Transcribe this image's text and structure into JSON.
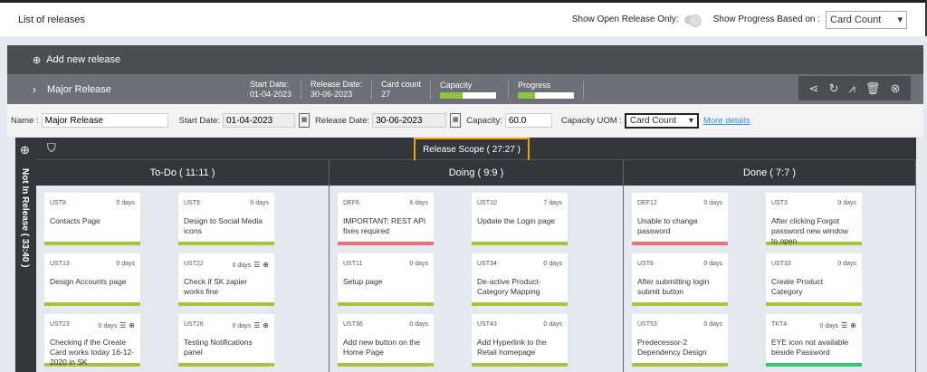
{
  "header": {
    "title": "List of releases",
    "open_only_label": "Show Open Release Only:",
    "progress_label": "Show Progress Based on :",
    "progress_value": "Card Count"
  },
  "add_release": "Add new release",
  "release": {
    "name": "Major Release",
    "start_label": "Start Date:",
    "start": "01-04-2023",
    "release_label": "Release Date:",
    "release": "30-06-2023",
    "card_label": "Card count",
    "card_count": "27",
    "capacity_label": "Capacity",
    "capacity_fill": 0.4,
    "progress_label": "Progress",
    "progress_fill": 0.3
  },
  "form": {
    "name_label": "Name :",
    "name": "Major Release",
    "start_label": "Start Date:",
    "start": "01-04-2023",
    "release_label": "Release Date:",
    "release": "30-06-2023",
    "capacity_label": "Capacity:",
    "capacity": "60.0",
    "uom_label": "Capacity UOM :",
    "uom": "Card Count",
    "more": "More details"
  },
  "board": {
    "not_in_release": "Not In Release ( 33:40 )",
    "scope": "Release Scope ( 27:27 )",
    "columns": [
      {
        "title": "To-Do ( 11:11 )",
        "cards": [
          {
            "id": "UST8",
            "days": "0 days",
            "title": "Contacts Page",
            "color": "#a5c63b",
            "icons": false
          },
          {
            "id": "UST9",
            "days": "0 days",
            "title": "Design to Social Media icons",
            "color": "#a5c63b",
            "icons": false
          },
          {
            "id": "UST13",
            "days": "0 days",
            "title": "Design Accounts page",
            "color": "#a5c63b",
            "icons": false
          },
          {
            "id": "UST22",
            "days": "0 days",
            "title": "Check if SK zapier works fine",
            "color": "#a5c63b",
            "icons": true
          },
          {
            "id": "UST23",
            "days": "0 days",
            "title": "Checking if the Create Card works today 16-12-2020 in SK",
            "color": "#a5c63b",
            "icons": true
          },
          {
            "id": "UST26",
            "days": "0 days",
            "title": "Testing Notifications panel",
            "color": "#a5c63b",
            "icons": true
          }
        ]
      },
      {
        "title": "Doing ( 9:9 )",
        "cards": [
          {
            "id": "DEF6",
            "days": "6 days",
            "title": "IMPORTANT: REST API fixes required",
            "color": "#ef6f78",
            "icons": false
          },
          {
            "id": "UST10",
            "days": "7 days",
            "title": "Update the Login page",
            "color": "#a5c63b",
            "icons": false
          },
          {
            "id": "UST11",
            "days": "0 days",
            "title": "Setup page",
            "color": "#a5c63b",
            "icons": false
          },
          {
            "id": "UST34",
            "days": "0 days",
            "title": "De-active Product-Category Mapping",
            "color": "#a5c63b",
            "icons": false
          },
          {
            "id": "UST36",
            "days": "0 days",
            "title": "Add new button on the Home Page",
            "color": "#a5c63b",
            "icons": false
          },
          {
            "id": "UST43",
            "days": "0 days",
            "title": "Add Hyperlink to the Retail homepage",
            "color": "#a5c63b",
            "icons": false
          }
        ]
      },
      {
        "title": "Done ( 7:7 )",
        "cards": [
          {
            "id": "DEF12",
            "days": "0 days",
            "title": "Unable to change password",
            "color": "#ef6f78",
            "icons": false
          },
          {
            "id": "UST3",
            "days": "0 days",
            "title": "After clicking Forgot password new window to open",
            "color": "#a5c63b",
            "icons": false
          },
          {
            "id": "UST6",
            "days": "0 days",
            "title": "After submitting login submit button",
            "color": "#a5c63b",
            "icons": false
          },
          {
            "id": "UST33",
            "days": "0 days",
            "title": "Create Product Category",
            "color": "#a5c63b",
            "icons": false
          },
          {
            "id": "UST53",
            "days": "0 days",
            "title": "Predecessor-2 Dependency Design",
            "color": "#a5c63b",
            "icons": false
          },
          {
            "id": "TKT4",
            "days": "0 days",
            "title": "EYE icon not available beside Password",
            "color": "#2ecc71",
            "icons": true
          }
        ]
      }
    ]
  }
}
